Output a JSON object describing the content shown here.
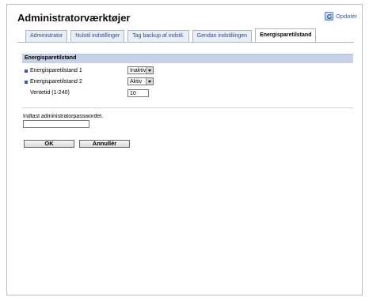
{
  "header": {
    "title": "Administratorværktøjer",
    "refresh_label": "Opdatér"
  },
  "tabs": [
    {
      "label": "Administrator",
      "active": false
    },
    {
      "label": "Nulstil indstillinger",
      "active": false
    },
    {
      "label": "Tag backup af indstil.",
      "active": false
    },
    {
      "label": "Gendan indstillingen",
      "active": false
    },
    {
      "label": "Energisparetilstand",
      "active": true
    }
  ],
  "section": {
    "title": "Energisparetilstand",
    "rows": [
      {
        "label": "Energisparetilstand 1",
        "value": "Inaktiv"
      },
      {
        "label": "Energisparetilstand 2",
        "value": "Aktiv"
      },
      {
        "label": "Ventetid (1-240)",
        "value": "10"
      }
    ]
  },
  "password": {
    "label": "Indtast administratorpasswordet.",
    "value": ""
  },
  "buttons": {
    "ok_label": "OK",
    "cancel_label": "Annullér"
  },
  "colors": {
    "accent": "#3b5aa0",
    "section_bar": "#c6d2e8",
    "tab_background": "#e9eef5"
  }
}
